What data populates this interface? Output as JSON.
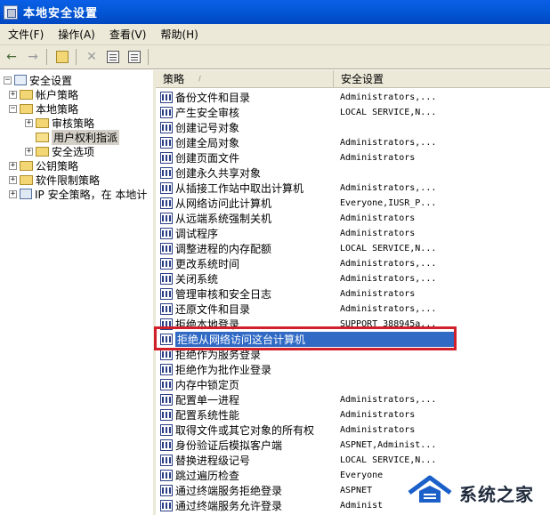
{
  "window": {
    "title": "本地安全设置"
  },
  "menu": {
    "items": [
      "文件(F)",
      "操作(A)",
      "查看(V)",
      "帮助(H)"
    ]
  },
  "tree": {
    "items": [
      {
        "label": "安全设置",
        "level": 0,
        "expander": "−",
        "icon": "computer-icon"
      },
      {
        "label": "帐户策略",
        "level": 1,
        "expander": "+",
        "icon": "folder-icon"
      },
      {
        "label": "本地策略",
        "level": 1,
        "expander": "−",
        "icon": "folder-icon"
      },
      {
        "label": "审核策略",
        "level": 2,
        "expander": "+",
        "icon": "folder-icon"
      },
      {
        "label": "用户权利指派",
        "level": 2,
        "expander": "",
        "icon": "folder-open-icon",
        "selected": true
      },
      {
        "label": "安全选项",
        "level": 2,
        "expander": "+",
        "icon": "folder-icon"
      },
      {
        "label": "公钥策略",
        "level": 1,
        "expander": "+",
        "icon": "folder-icon"
      },
      {
        "label": "软件限制策略",
        "level": 1,
        "expander": "+",
        "icon": "folder-icon"
      },
      {
        "label": "IP 安全策略，在 本地计",
        "level": 1,
        "expander": "+",
        "icon": "network-icon"
      }
    ]
  },
  "list": {
    "columns": [
      "策略",
      "安全设置"
    ],
    "sort_indicator": "/",
    "rows": [
      {
        "policy": "备份文件和目录",
        "setting": "Administrators,..."
      },
      {
        "policy": "产生安全审核",
        "setting": "LOCAL SERVICE,N..."
      },
      {
        "policy": "创建记号对象",
        "setting": ""
      },
      {
        "policy": "创建全局对象",
        "setting": "Administrators,..."
      },
      {
        "policy": "创建页面文件",
        "setting": "Administrators"
      },
      {
        "policy": "创建永久共享对象",
        "setting": ""
      },
      {
        "policy": "从插接工作站中取出计算机",
        "setting": "Administrators,..."
      },
      {
        "policy": "从网络访问此计算机",
        "setting": "Everyone,IUSR_P..."
      },
      {
        "policy": "从远端系统强制关机",
        "setting": "Administrators"
      },
      {
        "policy": "调试程序",
        "setting": "Administrators"
      },
      {
        "policy": "调整进程的内存配额",
        "setting": "LOCAL SERVICE,N..."
      },
      {
        "policy": "更改系统时间",
        "setting": "Administrators,..."
      },
      {
        "policy": "关闭系统",
        "setting": "Administrators,..."
      },
      {
        "policy": "管理审核和安全日志",
        "setting": "Administrators"
      },
      {
        "policy": "还原文件和目录",
        "setting": "Administrators,..."
      },
      {
        "policy": "拒绝本地登录",
        "setting": "SUPPORT_388945a..."
      },
      {
        "policy": "拒绝从网络访问这台计算机",
        "setting": "",
        "selected": true
      },
      {
        "policy": "拒绝作为服务登录",
        "setting": ""
      },
      {
        "policy": "拒绝作为批作业登录",
        "setting": ""
      },
      {
        "policy": "内存中锁定页",
        "setting": ""
      },
      {
        "policy": "配置单一进程",
        "setting": "Administrators,..."
      },
      {
        "policy": "配置系统性能",
        "setting": "Administrators"
      },
      {
        "policy": "取得文件或其它对象的所有权",
        "setting": "Administrators"
      },
      {
        "policy": "身份验证后模拟客户端",
        "setting": "ASPNET,Administ..."
      },
      {
        "policy": "替换进程级记号",
        "setting": "LOCAL SERVICE,N..."
      },
      {
        "policy": "跳过遍历检查",
        "setting": "Everyone"
      },
      {
        "policy": "通过终端服务拒绝登录",
        "setting": "ASPNET"
      },
      {
        "policy": "通过终端服务允许登录",
        "setting": "Administ"
      }
    ]
  },
  "watermark": {
    "text": "系统之家"
  }
}
